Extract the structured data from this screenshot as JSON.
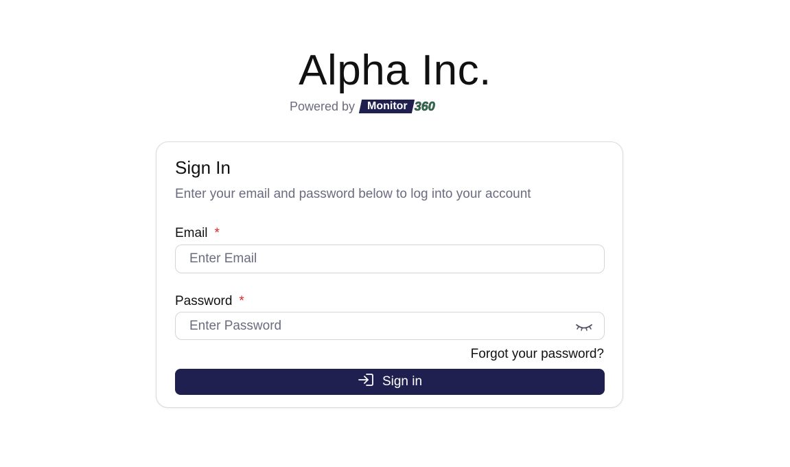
{
  "brand": {
    "title": "Alpha Inc.",
    "powered_by": "Powered by",
    "logo_word": "Monitor",
    "logo_number": "360"
  },
  "signin_card": {
    "title": "Sign In",
    "subtitle": "Enter your email and password below to log into your account",
    "email": {
      "label": "Email",
      "required_mark": "*",
      "placeholder": "Enter Email",
      "value": ""
    },
    "password": {
      "label": "Password",
      "required_mark": "*",
      "placeholder": "Enter Password",
      "value": "",
      "toggle_icon": "eye-closed-icon"
    },
    "forgot_link": "Forgot your password?",
    "submit_label": "Sign in",
    "submit_icon": "sign-in-icon"
  },
  "colors": {
    "primary": "#1f2050",
    "muted_text": "#6b6b80",
    "required": "#e02424",
    "logo_green": "#2f7d3a"
  }
}
